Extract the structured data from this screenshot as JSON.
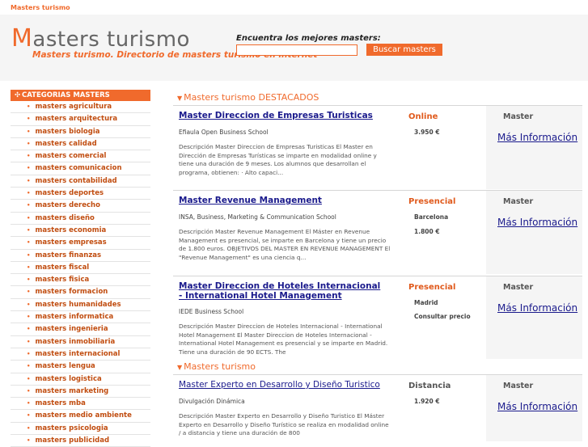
{
  "header": {
    "site_name": "Masters turismo",
    "logo_initial": "M",
    "logo_rest": "asters turismo",
    "tagline": "Masters turismo. Directorio de masters turismo en internet",
    "search_label": "Encuentra los mejores masters:",
    "search_value": "",
    "search_button": "Buscar masters"
  },
  "sidebar": {
    "title": "CATEGORIAS MASTERS",
    "items": [
      "masters agricultura",
      "masters arquitectura",
      "masters biologia",
      "masters calidad",
      "masters comercial",
      "masters comunicacion",
      "masters contabilidad",
      "masters deportes",
      "masters derecho",
      "masters diseño",
      "masters economia",
      "masters empresas",
      "masters finanzas",
      "masters fiscal",
      "masters fisica",
      "masters formacion",
      "masters humanidades",
      "masters informatica",
      "masters ingenieria",
      "masters inmobiliaria",
      "masters internacional",
      "masters lengua",
      "masters logistica",
      "masters marketing",
      "masters mba",
      "masters medio ambiente",
      "masters psicologia",
      "masters publicidad"
    ]
  },
  "sections": {
    "featured": "Masters turismo DESTACADOS",
    "regular": "Masters turismo"
  },
  "colors": {
    "accent": "#f06a2c",
    "link": "#1a1a8c",
    "online": "#e05a1c"
  },
  "listings": [
    {
      "title": "Master Direccion de Empresas Turisticas",
      "school": "Efiaula Open Business School",
      "description": "Descripción Master Direccion de Empresas Turisticas El Master en Dirección de Empresas Turísticas se imparte en modalidad online y tiene una duración de 9 meses. Los alumnos que desarrollan el programa, obtienen: ·     Alto capaci...",
      "modality": "Online",
      "city": "",
      "price": "3.950 €",
      "type": "Master",
      "info": "Más Información"
    },
    {
      "title": "Master Revenue Management",
      "school": "INSA, Business, Marketing & Communication School",
      "description": "Descripción Master Revenue Management El Máster en Revenue Management es presencial, se imparte en Barcelona y tiene un precio de 1.800 euros. OBJETIVOS DEL MASTER EN REVENUE MANAGEMENT El \"Revenue Management\" es una ciencia q...",
      "modality": "Presencial",
      "city": "Barcelona",
      "price": "1.800 €",
      "type": "Master",
      "info": "Más Información"
    },
    {
      "title": "Master Direccion de Hoteles Internacional - International Hotel Management",
      "school": "IEDE Business School",
      "description": "Descripción Master Direccion de Hoteles Internacional - International Hotel Management El Master Direccion de Hoteles Internacional - International Hotel Management es presencial y se imparte en Madrid. Tiene una duración de 90 ECTS. The",
      "modality": "Presencial",
      "city": "Madrid",
      "price": "Consultar precio",
      "type": "Master",
      "info": "Más Información"
    },
    {
      "title": "Master Experto en Desarrollo y Diseño Turistico",
      "school": "Divulgación Dinámica",
      "description": "Descripción Master Experto en Desarrollo y Diseño Turistico El Máster Experto en Desarrollo y Diseño Turístico se realiza en modalidad online / a distancia y tiene una duración de 800",
      "modality": "Distancia",
      "city": "",
      "price": "1.920 €",
      "type": "Master",
      "info": "Más Información"
    }
  ]
}
